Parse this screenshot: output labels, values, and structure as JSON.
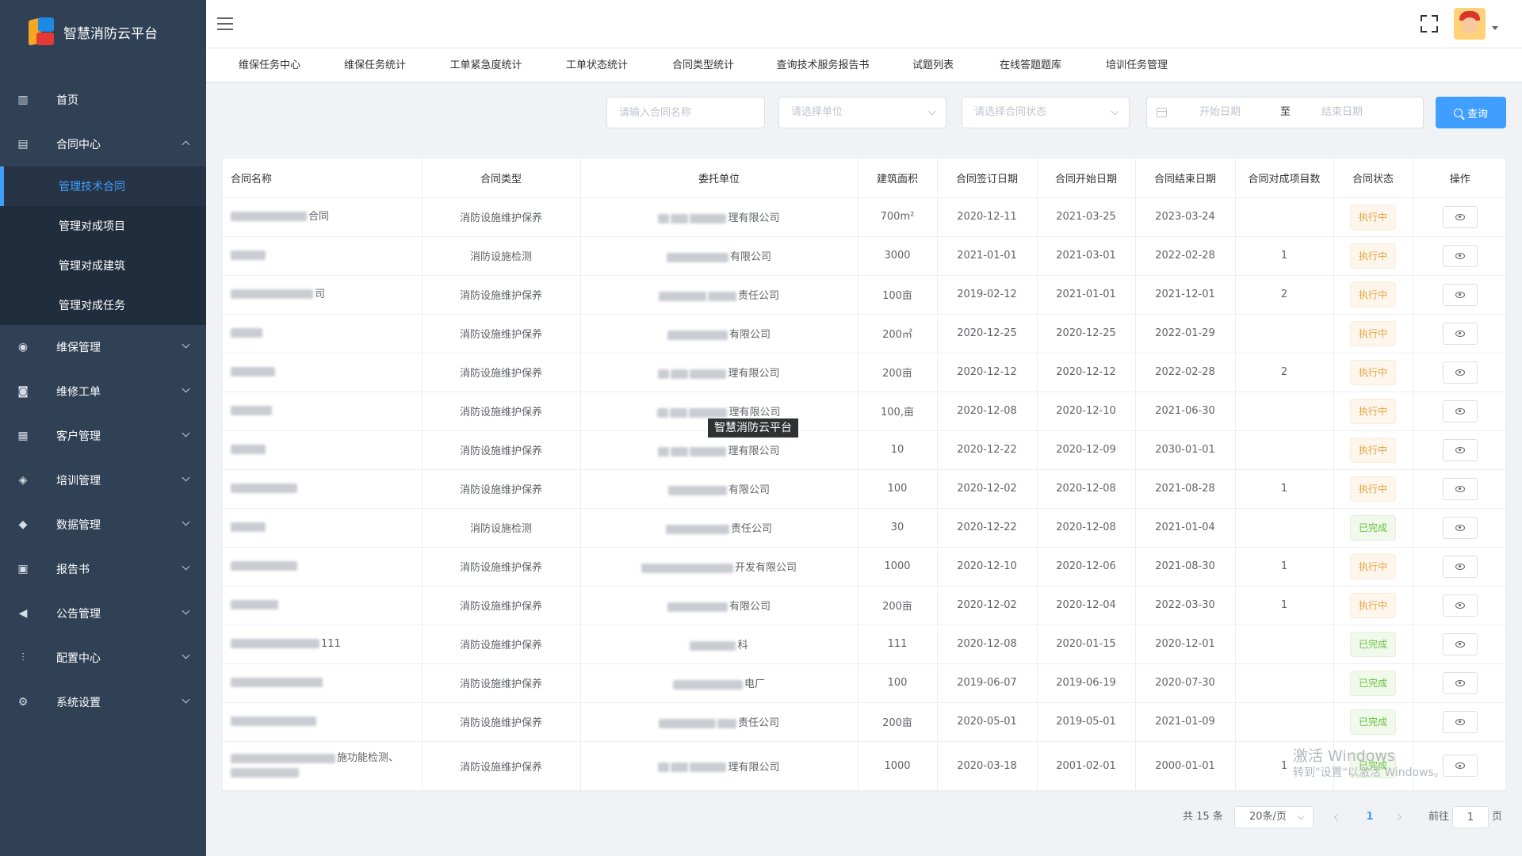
{
  "app": {
    "title": "智慧消防云平台"
  },
  "sidebar": {
    "items": [
      {
        "label": "首页",
        "icon": "bar-chart-icon",
        "glyph": "▥"
      },
      {
        "label": "合同中心",
        "icon": "contract-icon",
        "glyph": "▤",
        "expanded": true,
        "children": [
          {
            "label": "管理技术合同",
            "active": true
          },
          {
            "label": "管理对成项目"
          },
          {
            "label": "管理对成建筑"
          },
          {
            "label": "管理对成任务"
          }
        ]
      },
      {
        "label": "维保管理",
        "icon": "location-pin-icon",
        "glyph": "◉"
      },
      {
        "label": "维修工单",
        "icon": "lock-icon",
        "glyph": "◙"
      },
      {
        "label": "客户管理",
        "icon": "building-icon",
        "glyph": "▦"
      },
      {
        "label": "培训管理",
        "icon": "training-icon",
        "glyph": "◈"
      },
      {
        "label": "数据管理",
        "icon": "layers-icon",
        "glyph": "◆"
      },
      {
        "label": "报告书",
        "icon": "report-icon",
        "glyph": "▣"
      },
      {
        "label": "公告管理",
        "icon": "speaker-icon",
        "glyph": "◀"
      },
      {
        "label": "配置中心",
        "icon": "sliders-icon",
        "glyph": "⫶"
      },
      {
        "label": "系统设置",
        "icon": "gear-icon",
        "glyph": "⚙"
      }
    ]
  },
  "tabs": [
    "维保任务中心",
    "维保任务统计",
    "工单紧急度统计",
    "工单状态统计",
    "合同类型统计",
    "查询技术服务报告书",
    "试题列表",
    "在线答题题库",
    "培训任务管理"
  ],
  "search": {
    "contract_name_placeholder": "请输入合同名称",
    "unit_placeholder": "请选择单位",
    "status_placeholder": "请选择合同状态",
    "start_date_placeholder": "开始日期",
    "date_separator": "至",
    "end_date_placeholder": "结束日期",
    "query_label": "查询"
  },
  "table": {
    "columns": [
      "合同名称",
      "合同类型",
      "委托单位",
      "建筑面积",
      "合同签订日期",
      "合同开始日期",
      "合同结束日期",
      "合同对成项目数",
      "合同状态",
      "操作"
    ],
    "rows": [
      {
        "name_suffix": "合同",
        "type": "消防设施维护保养",
        "unit_suffix": "理有限公司",
        "area": "700m²",
        "signed": "2020-12-11",
        "start": "2021-03-25",
        "end": "2023-03-24",
        "count": "",
        "status": "执行中",
        "status_kind": "run"
      },
      {
        "name_suffix": "",
        "type": "消防设施检测",
        "unit_suffix": "有限公司",
        "area": "3000",
        "signed": "2021-01-01",
        "start": "2021-03-01",
        "end": "2022-02-28",
        "count": "1",
        "status": "执行中",
        "status_kind": "run"
      },
      {
        "name_suffix": "司",
        "type": "消防设施维护保养",
        "unit_suffix": "责任公司",
        "area": "100亩",
        "signed": "2019-02-12",
        "start": "2021-01-01",
        "end": "2021-12-01",
        "count": "2",
        "status": "执行中",
        "status_kind": "run"
      },
      {
        "name_suffix": "",
        "type": "消防设施维护保养",
        "unit_suffix": "有限公司",
        "area": "200㎡",
        "signed": "2020-12-25",
        "start": "2020-12-25",
        "end": "2022-01-29",
        "count": "",
        "status": "执行中",
        "status_kind": "run"
      },
      {
        "name_suffix": "",
        "type": "消防设施维护保养",
        "unit_suffix": "理有限公司",
        "area": "200亩",
        "signed": "2020-12-12",
        "start": "2020-12-12",
        "end": "2022-02-28",
        "count": "2",
        "status": "执行中",
        "status_kind": "run"
      },
      {
        "name_suffix": "",
        "type": "消防设施维护保养",
        "unit_suffix": "理有限公司",
        "area": "100,亩",
        "signed": "2020-12-08",
        "start": "2020-12-10",
        "end": "2021-06-30",
        "count": "",
        "status": "执行中",
        "status_kind": "run"
      },
      {
        "name_suffix": "",
        "type": "消防设施维护保养",
        "unit_suffix": "理有限公司",
        "area": "10",
        "signed": "2020-12-22",
        "start": "2020-12-09",
        "end": "2030-01-01",
        "count": "",
        "status": "执行中",
        "status_kind": "run"
      },
      {
        "name_suffix": "",
        "type": "消防设施维护保养",
        "unit_suffix": "有限公司",
        "area": "100",
        "signed": "2020-12-02",
        "start": "2020-12-08",
        "end": "2021-08-28",
        "count": "1",
        "status": "执行中",
        "status_kind": "run"
      },
      {
        "name_suffix": "",
        "type": "消防设施检测",
        "unit_suffix": "责任公司",
        "area": "30",
        "signed": "2020-12-22",
        "start": "2020-12-08",
        "end": "2021-01-04",
        "count": "",
        "status": "已完成",
        "status_kind": "done"
      },
      {
        "name_suffix": "",
        "type": "消防设施维护保养",
        "unit_suffix": "开发有限公司",
        "area": "1000",
        "signed": "2020-12-10",
        "start": "2020-12-06",
        "end": "2021-08-30",
        "count": "1",
        "status": "执行中",
        "status_kind": "run"
      },
      {
        "name_suffix": "",
        "type": "消防设施维护保养",
        "unit_suffix": "有限公司",
        "area": "200亩",
        "signed": "2020-12-02",
        "start": "2020-12-04",
        "end": "2022-03-30",
        "count": "1",
        "status": "执行中",
        "status_kind": "run"
      },
      {
        "name_suffix": "111",
        "type": "消防设施维护保养",
        "unit_suffix": "科",
        "area": "111",
        "signed": "2020-12-08",
        "start": "2020-01-15",
        "end": "2020-12-01",
        "count": "",
        "status": "已完成",
        "status_kind": "done"
      },
      {
        "name_suffix": "",
        "type": "消防设施维护保养",
        "unit_suffix": "电厂",
        "area": "100",
        "signed": "2019-06-07",
        "start": "2019-06-19",
        "end": "2020-07-30",
        "count": "",
        "status": "已完成",
        "status_kind": "done"
      },
      {
        "name_suffix": "",
        "type": "消防设施维护保养",
        "unit_suffix": "责任公司",
        "area": "200亩",
        "signed": "2020-05-01",
        "start": "2019-05-01",
        "end": "2021-01-09",
        "count": "",
        "status": "已完成",
        "status_kind": "done"
      },
      {
        "name_suffix": "施功能检测、",
        "type": "消防设施维护保养",
        "unit_suffix": "理有限公司",
        "area": "1000",
        "signed": "2020-03-18",
        "start": "2001-02-01",
        "end": "2000-01-01",
        "count": "1",
        "status": "已完成",
        "status_kind": "done",
        "tall": true
      }
    ]
  },
  "pagination": {
    "total": "共 15 条",
    "page_size": "20条/页",
    "current": "1",
    "goto_prefix": "前往",
    "goto_value": "1",
    "goto_suffix": "页"
  },
  "tooltip": "智慧消防云平台",
  "watermark": {
    "line1": "激活 Windows",
    "line2": "转到\"设置\"以激活 Windows。"
  },
  "colors": {
    "sidebar": "#304156",
    "accent": "#409eff",
    "running": "#e6a23c",
    "done": "#67c23a"
  }
}
